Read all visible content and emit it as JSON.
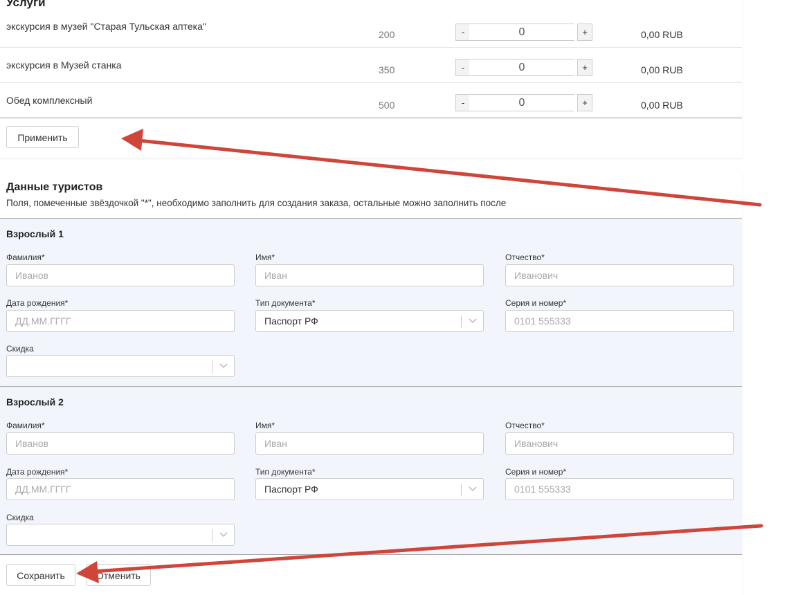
{
  "services": {
    "title": "Услуги",
    "rows": [
      {
        "name": "экскурсия в музей \"Старая Тульская аптека\"",
        "price": "200",
        "qty": "0",
        "total": "0,00 RUB"
      },
      {
        "name": "экскурсия в Музей станка",
        "price": "350",
        "qty": "0",
        "total": "0,00 RUB"
      },
      {
        "name": "Обед комплексный",
        "price": "500",
        "qty": "0",
        "total": "0,00 RUB"
      }
    ],
    "minus_label": "-",
    "plus_label": "+",
    "apply_label": "Применить"
  },
  "tourists": {
    "title": "Данные туристов",
    "note": "Поля, помеченные звёздочкой \"*\", необходимо заполнить для создания заказа, остальные можно заполнить после",
    "adults": [
      {
        "title": "Взрослый 1",
        "last_name_label": "Фамилия*",
        "last_name_placeholder": "Иванов",
        "first_name_label": "Имя*",
        "first_name_placeholder": "Иван",
        "middle_name_label": "Отчество*",
        "middle_name_placeholder": "Иванович",
        "birth_label": "Дата рождения*",
        "birth_placeholder": "ДД.ММ.ГГГГ",
        "doc_type_label": "Тип документа*",
        "doc_type_value": "Паспорт РФ",
        "doc_number_label": "Серия и номер*",
        "doc_number_placeholder": "0101 555333",
        "discount_label": "Скидка",
        "discount_value": ""
      },
      {
        "title": "Взрослый 2",
        "last_name_label": "Фамилия*",
        "last_name_placeholder": "Иванов",
        "first_name_label": "Имя*",
        "first_name_placeholder": "Иван",
        "middle_name_label": "Отчество*",
        "middle_name_placeholder": "Иванович",
        "birth_label": "Дата рождения*",
        "birth_placeholder": "ДД.ММ.ГГГГ",
        "doc_type_label": "Тип документа*",
        "doc_type_value": "Паспорт РФ",
        "doc_number_label": "Серия и номер*",
        "doc_number_placeholder": "0101 555333",
        "discount_label": "Скидка",
        "discount_value": ""
      }
    ],
    "save_label": "Сохранить",
    "cancel_label": "Отменить"
  },
  "colors": {
    "annotation_arrow": "#d0453a",
    "form_background": "#f2f6fc"
  }
}
